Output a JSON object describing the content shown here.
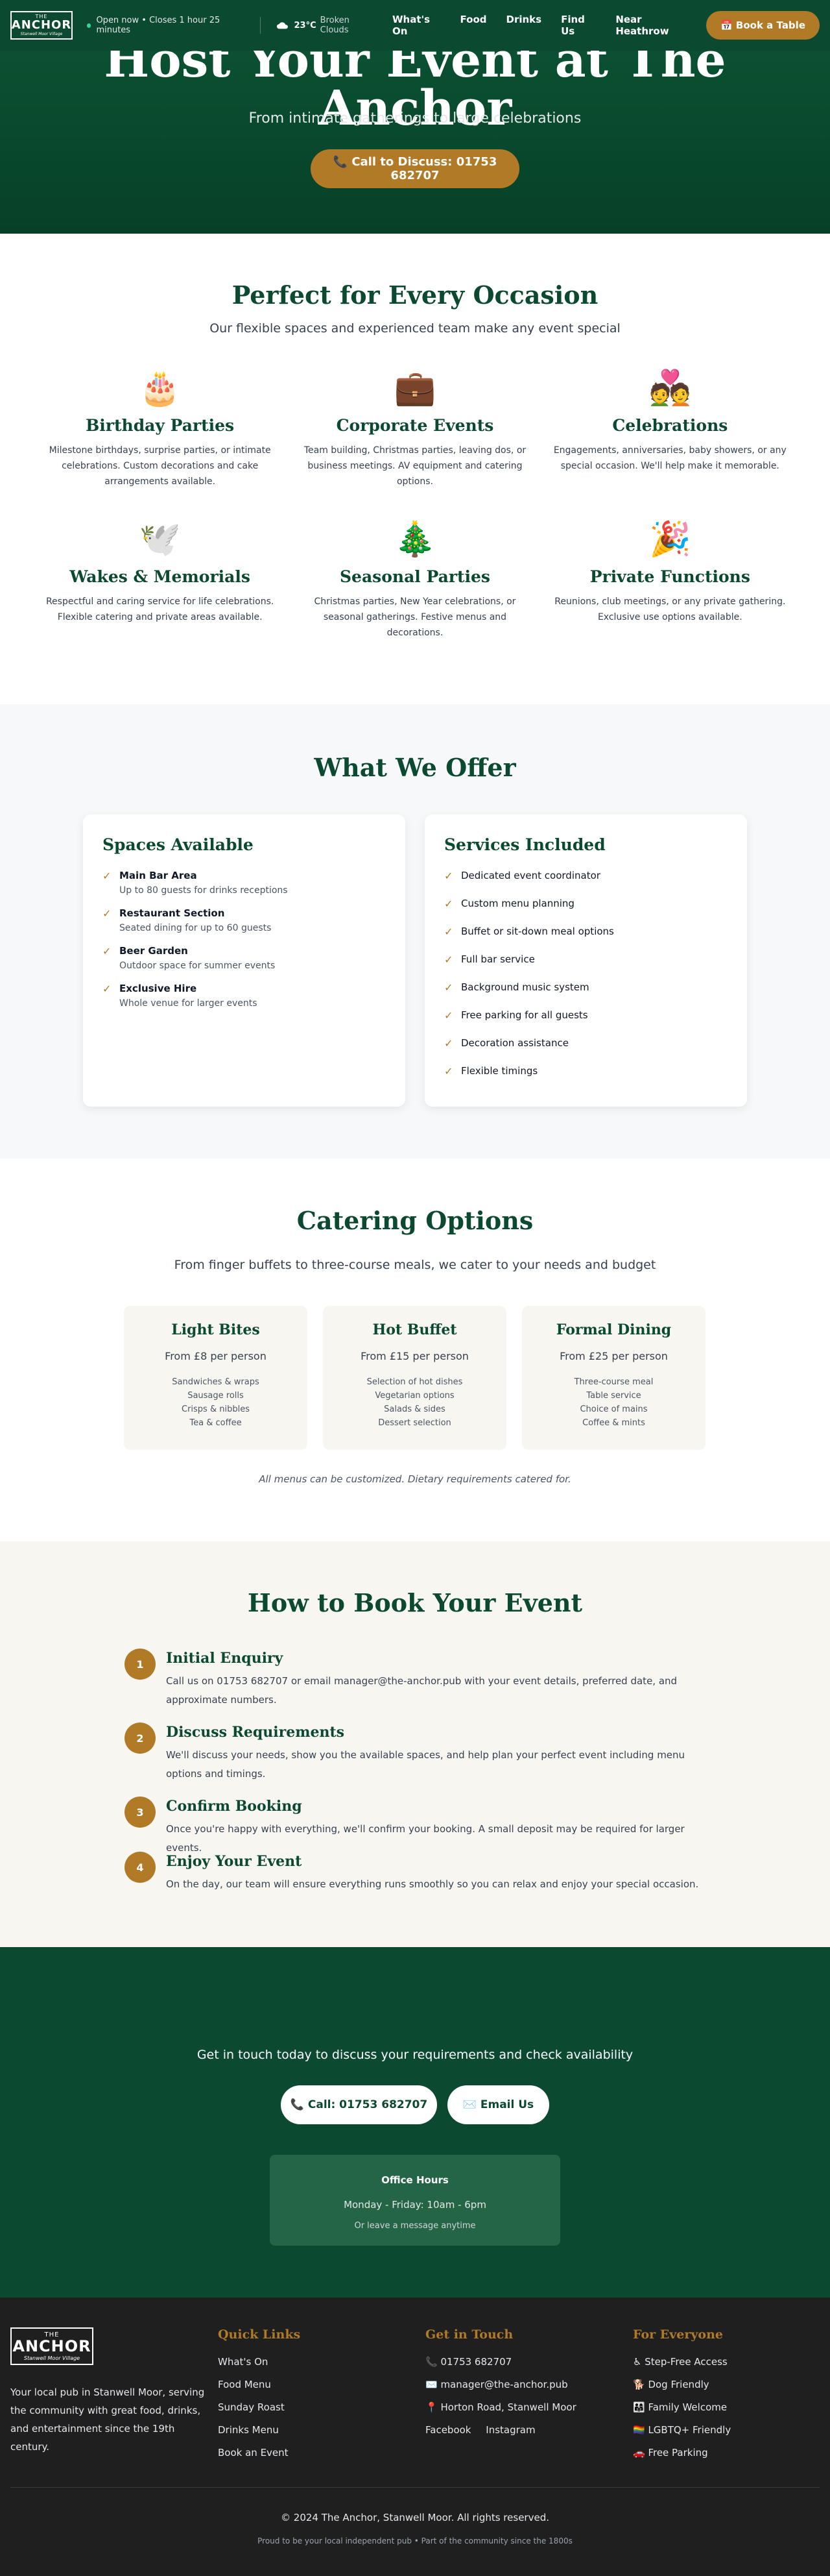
{
  "brand": {
    "top": "THE",
    "name": "ANCHOR",
    "tag": "Stanwell Moor Village"
  },
  "header": {
    "status": "Open now • Closes 1 hour 25 minutes",
    "weather": {
      "icon": "cloud-icon",
      "temp": "23°C",
      "condition": "Broken Clouds"
    },
    "nav": [
      "What's On",
      "Food",
      "Drinks",
      "Find Us",
      "Near Heathrow"
    ],
    "book_label": "📅 Book a Table"
  },
  "hero": {
    "title": "Host Your Event at The Anchor",
    "subtitle": "From intimate gatherings to large celebrations",
    "cta": "📞 Call to Discuss: 01753 682707"
  },
  "occasions": {
    "title": "Perfect for Every Occasion",
    "subtitle": "Our flexible spaces and experienced team make any event special",
    "items": [
      {
        "emoji": "🎂",
        "icon": "birthday-cake-icon",
        "title": "Birthday Parties",
        "text": "Milestone birthdays, surprise parties, or intimate celebrations. Custom decorations and cake arrangements available."
      },
      {
        "emoji": "💼",
        "icon": "briefcase-icon",
        "title": "Corporate Events",
        "text": "Team building, Christmas parties, leaving dos, or business meetings. AV equipment and catering options."
      },
      {
        "emoji": "💑",
        "icon": "couple-icon",
        "title": "Celebrations",
        "text": "Engagements, anniversaries, baby showers, or any special occasion. We'll help make it memorable."
      },
      {
        "emoji": "🕊️",
        "icon": "dove-icon",
        "title": "Wakes & Memorials",
        "text": "Respectful and caring service for life celebrations. Flexible catering and private areas available."
      },
      {
        "emoji": "🎄",
        "icon": "christmas-tree-icon",
        "title": "Seasonal Parties",
        "text": "Christmas parties, New Year celebrations, or seasonal gatherings. Festive menus and decorations."
      },
      {
        "emoji": "🎉",
        "icon": "party-popper-icon",
        "title": "Private Functions",
        "text": "Reunions, club meetings, or any private gathering. Exclusive use options available."
      }
    ]
  },
  "offer": {
    "title": "What We Offer",
    "spaces": {
      "title": "Spaces Available",
      "items": [
        {
          "name": "Main Bar Area",
          "desc": "Up to 80 guests for drinks receptions"
        },
        {
          "name": "Restaurant Section",
          "desc": "Seated dining for up to 60 guests"
        },
        {
          "name": "Beer Garden",
          "desc": "Outdoor space for summer events"
        },
        {
          "name": "Exclusive Hire",
          "desc": "Whole venue for larger events"
        }
      ]
    },
    "services": {
      "title": "Services Included",
      "items": [
        "Dedicated event coordinator",
        "Custom menu planning",
        "Buffet or sit-down meal options",
        "Full bar service",
        "Background music system",
        "Free parking for all guests",
        "Decoration assistance",
        "Flexible timings"
      ]
    },
    "check": "✓"
  },
  "catering": {
    "title": "Catering Options",
    "subtitle": "From finger buffets to three-course meals, we cater to your needs and budget",
    "options": [
      {
        "title": "Light Bites",
        "price": "From £8 per person",
        "items": [
          "Sandwiches & wraps",
          "Sausage rolls",
          "Crisps & nibbles",
          "Tea & coffee"
        ]
      },
      {
        "title": "Hot Buffet",
        "price": "From £15 per person",
        "items": [
          "Selection of hot dishes",
          "Vegetarian options",
          "Salads & sides",
          "Dessert selection"
        ]
      },
      {
        "title": "Formal Dining",
        "price": "From £25 per person",
        "items": [
          "Three-course meal",
          "Table service",
          "Choice of mains",
          "Coffee & mints"
        ]
      }
    ],
    "note": "All menus can be customized. Dietary requirements catered for."
  },
  "booking": {
    "title": "How to Book Your Event",
    "steps": [
      {
        "num": "1",
        "title": "Initial Enquiry",
        "text": "Call us on 01753 682707 or email manager@the-anchor.pub with your event details, preferred date, and approximate numbers."
      },
      {
        "num": "2",
        "title": "Discuss Requirements",
        "text": "We'll discuss your needs, show you the available spaces, and help plan your perfect event including menu options and timings."
      },
      {
        "num": "3",
        "title": "Confirm Booking",
        "text": "Once you're happy with everything, we'll confirm your booking. A small deposit may be required for larger events."
      },
      {
        "num": "4",
        "title": "Enjoy Your Event",
        "text": "On the day, our team will ensure everything runs smoothly so you can relax and enjoy your special occasion."
      }
    ]
  },
  "cta": {
    "text": "Get in touch today to discuss your requirements and check availability",
    "call": "📞 Call: 01753 682707",
    "email": "✉️ Email Us",
    "hours_title": "Office Hours",
    "hours": "Monday - Friday: 10am - 6pm",
    "hours_note": "Or leave a message anytime"
  },
  "footer": {
    "desc": "Your local pub in Stanwell Moor, serving the community with great food, drinks, and entertainment since the 19th century.",
    "quick_title": "Quick Links",
    "quick_links": [
      "What's On",
      "Food Menu",
      "Sunday Roast",
      "Drinks Menu",
      "Book an Event"
    ],
    "touch_title": "Get in Touch",
    "phone": "📞 01753 682707",
    "email": "✉️ manager@the-anchor.pub",
    "address": "📍 Horton Road, Stanwell Moor",
    "social": [
      "Facebook",
      "Instagram"
    ],
    "everyone_title": "For Everyone",
    "everyone": [
      "♿ Step-Free Access",
      "🐕 Dog Friendly",
      "👨‍👩‍👧 Family Welcome",
      "🏳️‍🌈 LGBTQ+ Friendly",
      "🚗 Free Parking"
    ],
    "copyright": "© 2024 The Anchor, Stanwell Moor. All rights reserved.",
    "tagline": "Proud to be your local independent pub • Part of the community since the 1800s"
  }
}
